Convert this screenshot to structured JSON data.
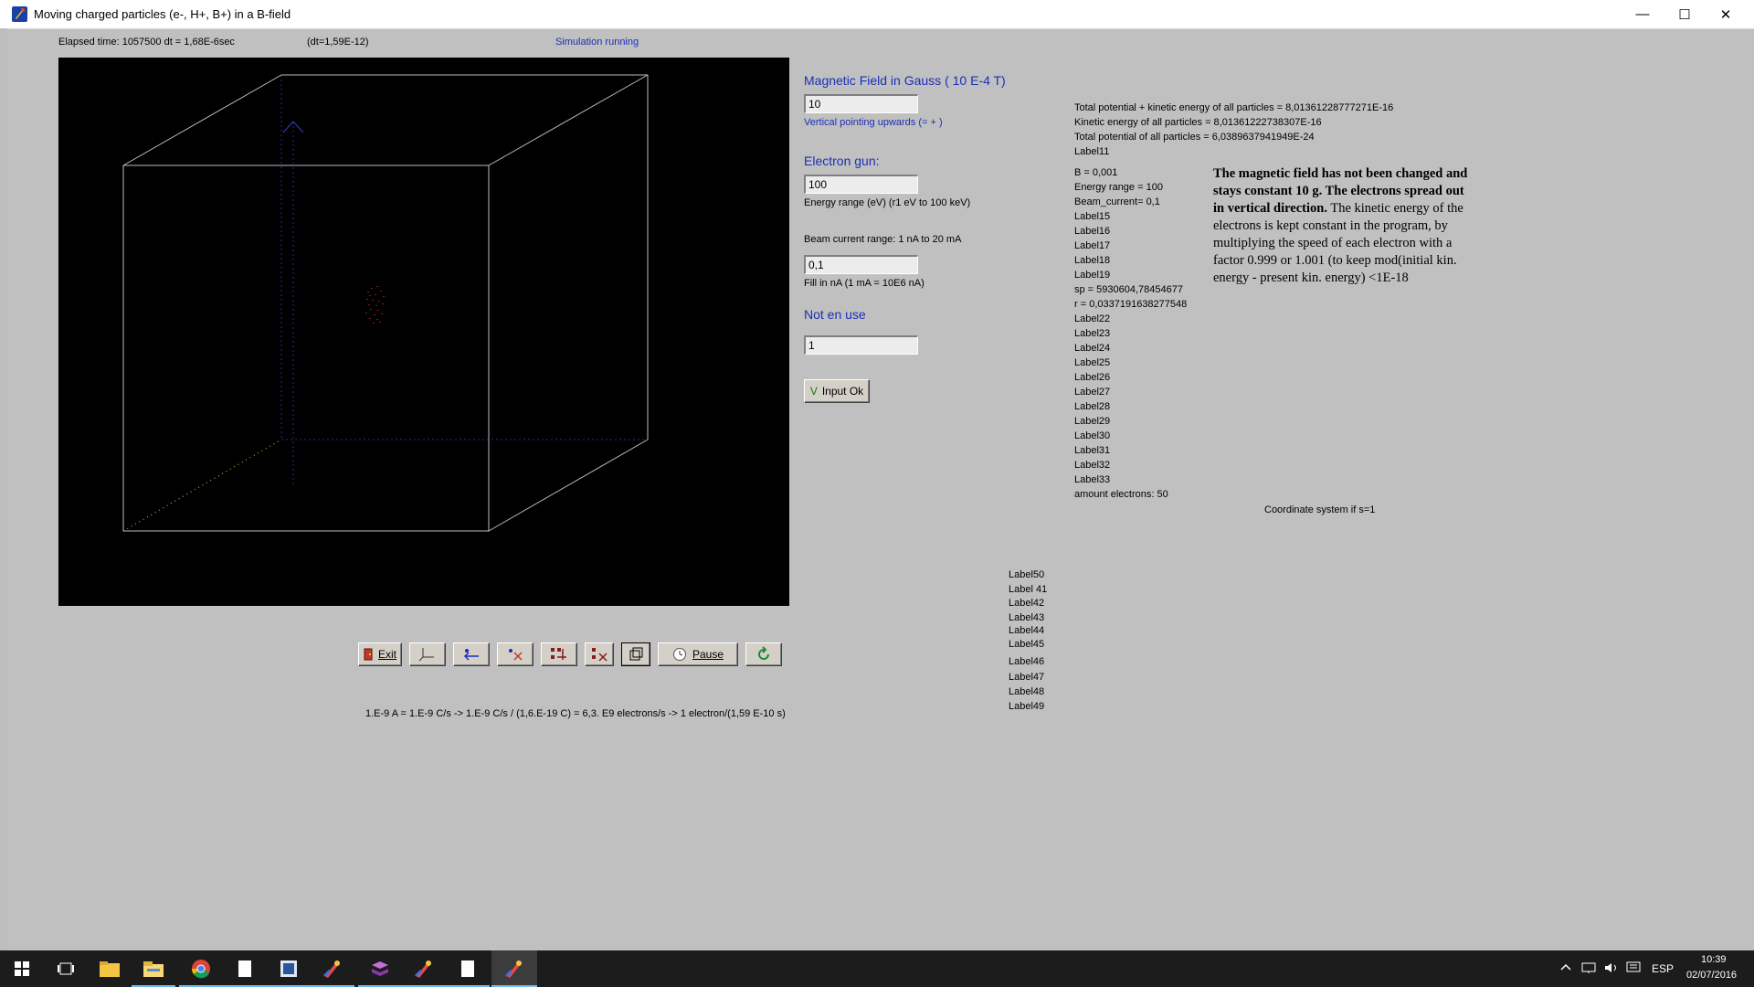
{
  "window": {
    "title": "Moving charged particles (e-, H+, B+) in a B-field",
    "minimize": "—",
    "maximize": "☐",
    "close": "✕"
  },
  "status": {
    "elapsed": "Elapsed time: 1057500 dt   = 1,68E-6sec",
    "dt": "(dt=1,59E-12)",
    "running": "Simulation running"
  },
  "controls": {
    "mag_heading": "Magnetic Field in Gauss ( 10 E-4 T)",
    "mag_value": "10",
    "mag_hint": "Vertical pointing upwards (= + )",
    "gun_heading": "Electron gun:",
    "gun_value": "100",
    "energy_range": "Energy range (eV)      (r1 eV to 100 keV)",
    "beam_range": "Beam current range: 1 nA to 20 mA",
    "beam_value": "0,1",
    "fill_hint": "Fill in nA (1 mA = 10E6 nA)",
    "notuse_heading": "Not en use",
    "notuse_value": "1",
    "input_ok_check": "V",
    "input_ok": "Input Ok"
  },
  "energy": {
    "total": "Total potential + kinetic energy of all particles = 8,01361228777271E-16",
    "kinetic": "Kinetic energy of all particles = 8,01361222738307E-16",
    "potential": "Total potential of all particles = 6,0389637941949E-24",
    "label11": "Label11"
  },
  "readouts": [
    "B = 0,001",
    "Energy range = 100",
    "Beam_current= 0,1",
    "Label15",
    "Label16",
    "Label17",
    "Label18",
    "Label19",
    "sp =  5930604,78454677",
    "r =  0,0337191638277548",
    "Label22",
    "Label23",
    "Label24",
    "Label25",
    "Label26",
    "Label27",
    "Label28",
    "Label29",
    "Label30",
    "Label31",
    "Label32",
    "Label33",
    "amount electrons: 50"
  ],
  "coord_note": "Coordinate system if s=1",
  "note": {
    "bold": "The magnetic field has not been changed and stays constant 10 g. The electrons spread out in vertical direction.",
    "text": "The kinetic energy of the electrons is kept constant in the program, by multiplying the speed of each electron with a factor 0.999 or 1.001 (to keep mod(initial kin. energy - present kin. energy) <1E-18"
  },
  "labels_col": [
    "Label50",
    "Label 41",
    "Label42",
    "Label43",
    "Label44",
    "Label45",
    "Label46",
    "Label47",
    "Label48",
    "Label49"
  ],
  "toolbar": {
    "exit": "Exit",
    "pause": "Pause"
  },
  "formula": "1.E-9 A = 1.E-9 C/s  ->  1.E-9 C/s / (1,6.E-19 C) = 6,3. E9   electrons/s  -> 1 electron/(1,59 E-10 s)",
  "taskbar": {
    "lang": "ESP",
    "time": "10:39",
    "date": "02/07/2016"
  },
  "colors": {
    "window_bg": "#c0c0c0",
    "heading_blue": "#1a2fb8",
    "canvas_bg": "#000000",
    "taskbar": "#1c1c1c",
    "particles": "#8b1a1a"
  }
}
